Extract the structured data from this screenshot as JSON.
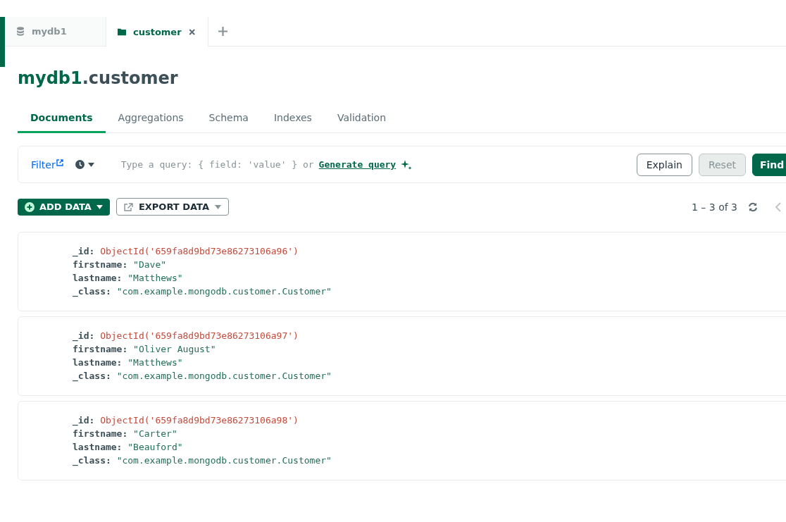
{
  "tabs": [
    {
      "label": "mydb1",
      "kind": "database",
      "selected": false
    },
    {
      "label": "customer",
      "kind": "collection",
      "selected": true
    }
  ],
  "title": {
    "database": "mydb1",
    "collection": ".customer"
  },
  "view_tabs": [
    {
      "label": "Documents",
      "selected": true
    },
    {
      "label": "Aggregations",
      "selected": false
    },
    {
      "label": "Schema",
      "selected": false
    },
    {
      "label": "Indexes",
      "selected": false
    },
    {
      "label": "Validation",
      "selected": false
    }
  ],
  "query_bar": {
    "filter_label": "Filter",
    "placeholder": "Type a query: { field: 'value' } or",
    "generate_link": "Generate query",
    "buttons": [
      {
        "label": "Explain",
        "kind": "outline",
        "disabled": false
      },
      {
        "label": "Reset",
        "kind": "outline",
        "disabled": true
      },
      {
        "label": "Find",
        "kind": "primary",
        "disabled": false
      }
    ]
  },
  "toolbar": {
    "add_data": "ADD DATA",
    "export_data": "EXPORT DATA",
    "pagination": "1 – 3 of 3"
  },
  "documents": [
    {
      "fields": [
        {
          "key": "_id:",
          "value": "ObjectId('659fa8d9bd73e86273106a96')",
          "kind": "objectid"
        },
        {
          "key": "firstname:",
          "value": "\"Dave\"",
          "kind": "string"
        },
        {
          "key": "lastname:",
          "value": "\"Matthews\"",
          "kind": "string"
        },
        {
          "key": "_class:",
          "value": "\"com.example.mongodb.customer.Customer\"",
          "kind": "string"
        }
      ]
    },
    {
      "fields": [
        {
          "key": "_id:",
          "value": "ObjectId('659fa8d9bd73e86273106a97')",
          "kind": "objectid"
        },
        {
          "key": "firstname:",
          "value": "\"Oliver August\"",
          "kind": "string"
        },
        {
          "key": "lastname:",
          "value": "\"Matthews\"",
          "kind": "string"
        },
        {
          "key": "_class:",
          "value": "\"com.example.mongodb.customer.Customer\"",
          "kind": "string"
        }
      ]
    },
    {
      "fields": [
        {
          "key": "_id:",
          "value": "ObjectId('659fa8d9bd73e86273106a98')",
          "kind": "objectid"
        },
        {
          "key": "firstname:",
          "value": "\"Carter\"",
          "kind": "string"
        },
        {
          "key": "lastname:",
          "value": "\"Beauford\"",
          "kind": "string"
        },
        {
          "key": "_class:",
          "value": "\"com.example.mongodb.customer.Customer\"",
          "kind": "string"
        }
      ]
    }
  ]
}
